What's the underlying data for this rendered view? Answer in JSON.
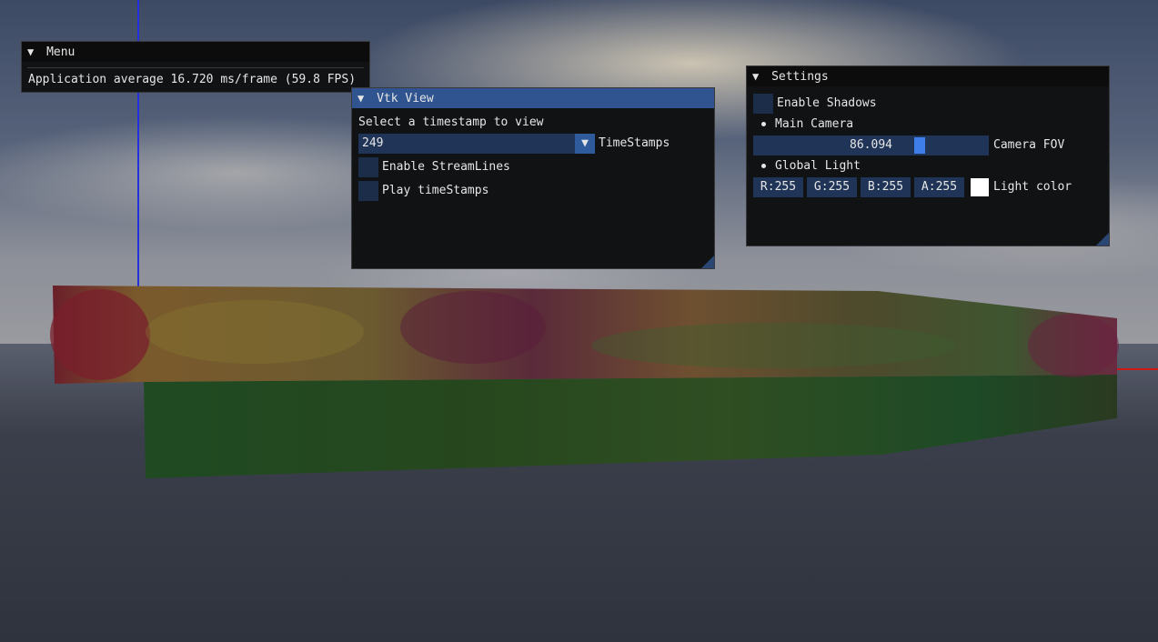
{
  "menu_window": {
    "title": "Menu",
    "fps_text": "Application average 16.720 ms/frame (59.8 FPS)"
  },
  "vtk_window": {
    "title": "Vtk View",
    "prompt": "Select a timestamp to view",
    "timestamp_value": "249",
    "timestamp_label": "TimeStamps",
    "streamlines_label": "Enable StreamLines",
    "play_label": "Play timeStamps",
    "streamlines_checked": false,
    "play_checked": false
  },
  "settings_window": {
    "title": "Settings",
    "shadows_label": "Enable Shadows",
    "shadows_checked": false,
    "main_camera_label": "Main Camera",
    "fov_value": "86.094",
    "fov_label": "Camera FOV",
    "global_light_label": "Global Light",
    "r_text": "R:255",
    "g_text": "G:255",
    "b_text": "B:255",
    "a_text": "A:255",
    "light_color_label": "Light color",
    "light_color": "#ffffff"
  },
  "icons": {
    "collapse": "▼",
    "combo_arrow": "▼"
  },
  "colors": {
    "title_active": "#2f548f",
    "frame_bg": "#1f3457",
    "slider_grab": "#3d7ee8",
    "axis_y": "#2230e0",
    "axis_x": "#d01818"
  }
}
